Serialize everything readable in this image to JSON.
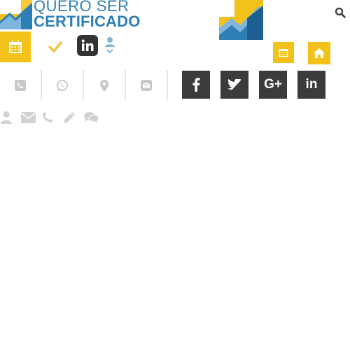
{
  "header": {
    "brand_line1": "QUERO SER",
    "brand_line2": "CERTIFICADO"
  },
  "colors": {
    "accent_yellow": "#f2c21b",
    "brand_blue": "#2f7fb7",
    "light_blue": "#7fb6dd",
    "social_dark": "#3b3b3b",
    "icon_gray": "#c8c8c8",
    "check_yellow": "#f0c24b"
  },
  "icons": {
    "top_left": [
      "calendar-icon",
      "check-icon",
      "linkedin-icon",
      "user-icon",
      "chevron-down-icon"
    ],
    "top_right": [
      "search-icon",
      "calendar-icon",
      "home-icon"
    ],
    "contact": [
      "phone-icon",
      "whatsapp-icon",
      "map-marker-icon",
      "envelope-icon"
    ],
    "social": [
      "facebook-icon",
      "twitter-icon",
      "google-plus-icon",
      "linkedin-icon"
    ],
    "form": [
      "user-icon",
      "envelope-icon",
      "phone-icon",
      "pencil-icon",
      "comments-icon"
    ]
  },
  "social": {
    "google_plus_label": "G+",
    "linkedin_label": "in"
  }
}
